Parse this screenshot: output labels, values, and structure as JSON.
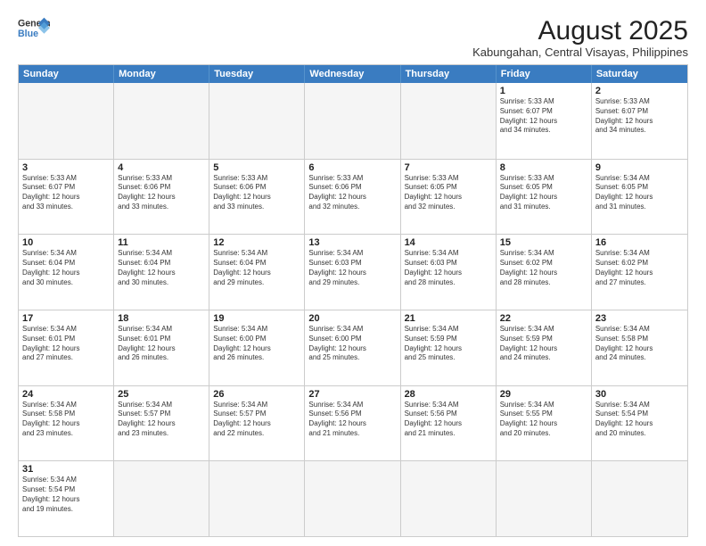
{
  "header": {
    "logo_general": "General",
    "logo_blue": "Blue",
    "title": "August 2025",
    "subtitle": "Kabungahan, Central Visayas, Philippines"
  },
  "weekdays": [
    "Sunday",
    "Monday",
    "Tuesday",
    "Wednesday",
    "Thursday",
    "Friday",
    "Saturday"
  ],
  "weeks": [
    [
      {
        "day": "",
        "info": "",
        "empty": true
      },
      {
        "day": "",
        "info": "",
        "empty": true
      },
      {
        "day": "",
        "info": "",
        "empty": true
      },
      {
        "day": "",
        "info": "",
        "empty": true
      },
      {
        "day": "",
        "info": "",
        "empty": true
      },
      {
        "day": "1",
        "info": "Sunrise: 5:33 AM\nSunset: 6:07 PM\nDaylight: 12 hours\nand 34 minutes."
      },
      {
        "day": "2",
        "info": "Sunrise: 5:33 AM\nSunset: 6:07 PM\nDaylight: 12 hours\nand 34 minutes."
      }
    ],
    [
      {
        "day": "3",
        "info": "Sunrise: 5:33 AM\nSunset: 6:07 PM\nDaylight: 12 hours\nand 33 minutes."
      },
      {
        "day": "4",
        "info": "Sunrise: 5:33 AM\nSunset: 6:06 PM\nDaylight: 12 hours\nand 33 minutes."
      },
      {
        "day": "5",
        "info": "Sunrise: 5:33 AM\nSunset: 6:06 PM\nDaylight: 12 hours\nand 33 minutes."
      },
      {
        "day": "6",
        "info": "Sunrise: 5:33 AM\nSunset: 6:06 PM\nDaylight: 12 hours\nand 32 minutes."
      },
      {
        "day": "7",
        "info": "Sunrise: 5:33 AM\nSunset: 6:05 PM\nDaylight: 12 hours\nand 32 minutes."
      },
      {
        "day": "8",
        "info": "Sunrise: 5:33 AM\nSunset: 6:05 PM\nDaylight: 12 hours\nand 31 minutes."
      },
      {
        "day": "9",
        "info": "Sunrise: 5:34 AM\nSunset: 6:05 PM\nDaylight: 12 hours\nand 31 minutes."
      }
    ],
    [
      {
        "day": "10",
        "info": "Sunrise: 5:34 AM\nSunset: 6:04 PM\nDaylight: 12 hours\nand 30 minutes."
      },
      {
        "day": "11",
        "info": "Sunrise: 5:34 AM\nSunset: 6:04 PM\nDaylight: 12 hours\nand 30 minutes."
      },
      {
        "day": "12",
        "info": "Sunrise: 5:34 AM\nSunset: 6:04 PM\nDaylight: 12 hours\nand 29 minutes."
      },
      {
        "day": "13",
        "info": "Sunrise: 5:34 AM\nSunset: 6:03 PM\nDaylight: 12 hours\nand 29 minutes."
      },
      {
        "day": "14",
        "info": "Sunrise: 5:34 AM\nSunset: 6:03 PM\nDaylight: 12 hours\nand 28 minutes."
      },
      {
        "day": "15",
        "info": "Sunrise: 5:34 AM\nSunset: 6:02 PM\nDaylight: 12 hours\nand 28 minutes."
      },
      {
        "day": "16",
        "info": "Sunrise: 5:34 AM\nSunset: 6:02 PM\nDaylight: 12 hours\nand 27 minutes."
      }
    ],
    [
      {
        "day": "17",
        "info": "Sunrise: 5:34 AM\nSunset: 6:01 PM\nDaylight: 12 hours\nand 27 minutes."
      },
      {
        "day": "18",
        "info": "Sunrise: 5:34 AM\nSunset: 6:01 PM\nDaylight: 12 hours\nand 26 minutes."
      },
      {
        "day": "19",
        "info": "Sunrise: 5:34 AM\nSunset: 6:00 PM\nDaylight: 12 hours\nand 26 minutes."
      },
      {
        "day": "20",
        "info": "Sunrise: 5:34 AM\nSunset: 6:00 PM\nDaylight: 12 hours\nand 25 minutes."
      },
      {
        "day": "21",
        "info": "Sunrise: 5:34 AM\nSunset: 5:59 PM\nDaylight: 12 hours\nand 25 minutes."
      },
      {
        "day": "22",
        "info": "Sunrise: 5:34 AM\nSunset: 5:59 PM\nDaylight: 12 hours\nand 24 minutes."
      },
      {
        "day": "23",
        "info": "Sunrise: 5:34 AM\nSunset: 5:58 PM\nDaylight: 12 hours\nand 24 minutes."
      }
    ],
    [
      {
        "day": "24",
        "info": "Sunrise: 5:34 AM\nSunset: 5:58 PM\nDaylight: 12 hours\nand 23 minutes."
      },
      {
        "day": "25",
        "info": "Sunrise: 5:34 AM\nSunset: 5:57 PM\nDaylight: 12 hours\nand 23 minutes."
      },
      {
        "day": "26",
        "info": "Sunrise: 5:34 AM\nSunset: 5:57 PM\nDaylight: 12 hours\nand 22 minutes."
      },
      {
        "day": "27",
        "info": "Sunrise: 5:34 AM\nSunset: 5:56 PM\nDaylight: 12 hours\nand 21 minutes."
      },
      {
        "day": "28",
        "info": "Sunrise: 5:34 AM\nSunset: 5:56 PM\nDaylight: 12 hours\nand 21 minutes."
      },
      {
        "day": "29",
        "info": "Sunrise: 5:34 AM\nSunset: 5:55 PM\nDaylight: 12 hours\nand 20 minutes."
      },
      {
        "day": "30",
        "info": "Sunrise: 5:34 AM\nSunset: 5:54 PM\nDaylight: 12 hours\nand 20 minutes."
      }
    ],
    [
      {
        "day": "31",
        "info": "Sunrise: 5:34 AM\nSunset: 5:54 PM\nDaylight: 12 hours\nand 19 minutes."
      },
      {
        "day": "",
        "info": "",
        "empty": true
      },
      {
        "day": "",
        "info": "",
        "empty": true
      },
      {
        "day": "",
        "info": "",
        "empty": true
      },
      {
        "day": "",
        "info": "",
        "empty": true
      },
      {
        "day": "",
        "info": "",
        "empty": true
      },
      {
        "day": "",
        "info": "",
        "empty": true
      }
    ]
  ]
}
